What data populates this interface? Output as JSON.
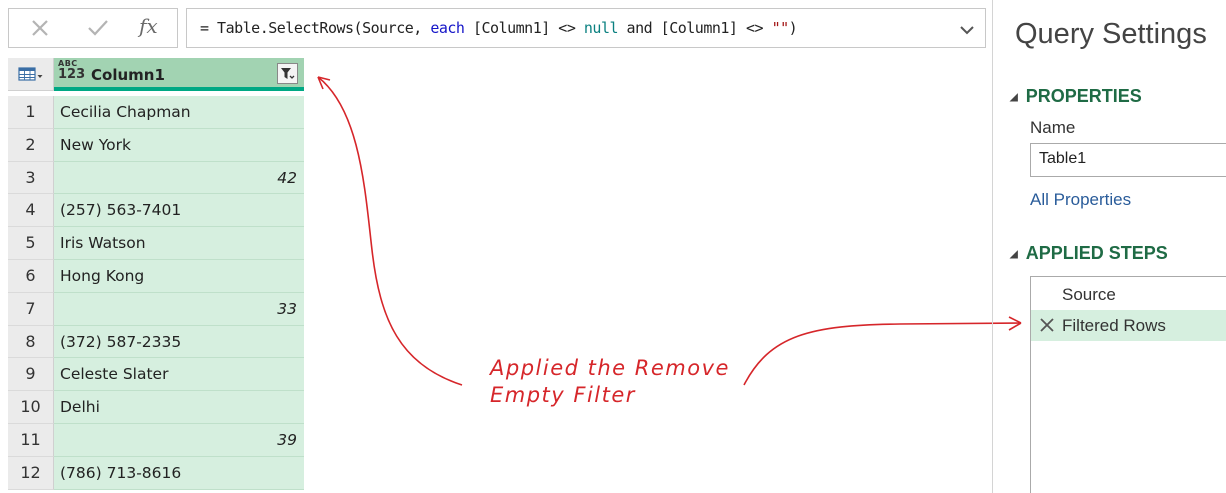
{
  "formula_bar": {
    "cancel_icon": "close-icon",
    "commit_icon": "checkmark-icon",
    "fx_label": "fx",
    "formula_parts": [
      {
        "text": "= Table.SelectRows(Source, ",
        "cls": ""
      },
      {
        "text": "each",
        "cls": "kw"
      },
      {
        "text": " [Column1] <> ",
        "cls": ""
      },
      {
        "text": "null",
        "cls": "null"
      },
      {
        "text": " and [Column1] <> ",
        "cls": ""
      },
      {
        "text": "\"\"",
        "cls": "str"
      },
      {
        "text": ")",
        "cls": ""
      }
    ]
  },
  "grid": {
    "type_abc": "ABC",
    "type_123": "123",
    "column_header": "Column1",
    "rows": [
      {
        "n": "1",
        "value": "Cecilia Chapman",
        "numeric": false
      },
      {
        "n": "2",
        "value": "New York",
        "numeric": false
      },
      {
        "n": "3",
        "value": "42",
        "numeric": true
      },
      {
        "n": "4",
        "value": "(257) 563-7401",
        "numeric": false
      },
      {
        "n": "5",
        "value": "Iris Watson",
        "numeric": false
      },
      {
        "n": "6",
        "value": "Hong Kong",
        "numeric": false
      },
      {
        "n": "7",
        "value": "33",
        "numeric": true
      },
      {
        "n": "8",
        "value": "(372) 587-2335",
        "numeric": false
      },
      {
        "n": "9",
        "value": "Celeste Slater",
        "numeric": false
      },
      {
        "n": "10",
        "value": "Delhi",
        "numeric": false
      },
      {
        "n": "11",
        "value": "39",
        "numeric": true
      },
      {
        "n": "12",
        "value": "(786) 713-8616",
        "numeric": false
      }
    ]
  },
  "annotation": {
    "line1": "Applied the Remove",
    "line2": "Empty Filter",
    "color": "#d6262a"
  },
  "query_settings": {
    "title": "Query Settings",
    "properties_header": "PROPERTIES",
    "name_label": "Name",
    "name_value": "Table1",
    "all_properties": "All Properties",
    "applied_steps_header": "APPLIED STEPS",
    "steps": [
      {
        "label": "Source",
        "selected": false,
        "deletable": false
      },
      {
        "label": "Filtered Rows",
        "selected": true,
        "deletable": true
      }
    ]
  },
  "colors": {
    "header_green": "#a2d3b2",
    "cell_green": "#d6efdf",
    "accent_teal": "#00a884",
    "section_green": "#1f6b45",
    "link_blue": "#2a5c9a"
  }
}
